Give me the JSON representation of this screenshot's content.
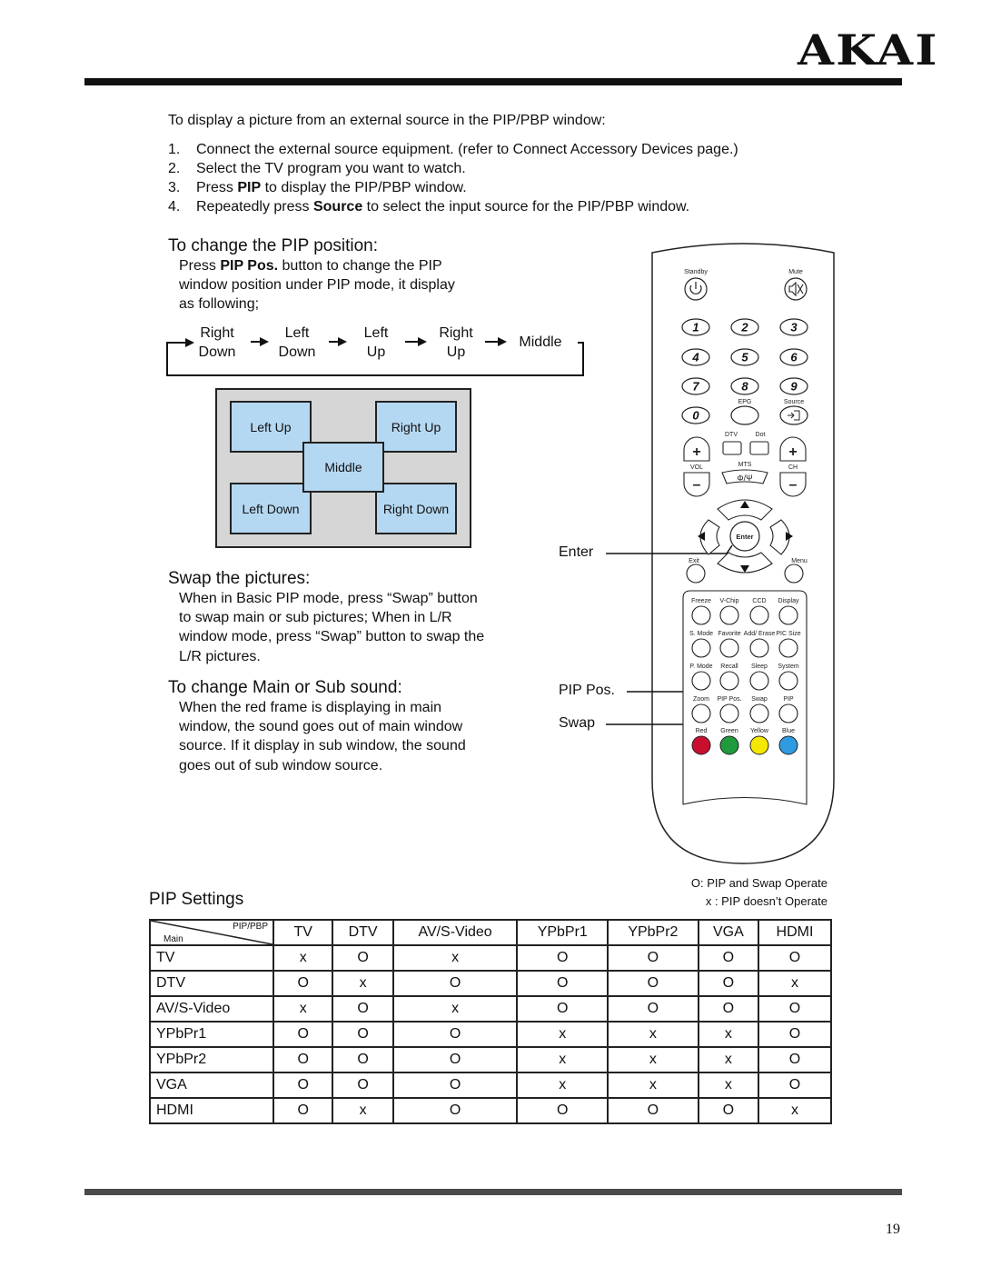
{
  "brand": "AKAI",
  "page_number": "19",
  "intro": "To display a picture from an external source in the PIP/PBP window:",
  "steps": [
    {
      "num": "1.",
      "pre": "Connect the external source equipment. (refer to Connect Accessory Devices page.)",
      "bold": "",
      "post": ""
    },
    {
      "num": "2.",
      "pre": "Select the TV program you want to watch.",
      "bold": "",
      "post": ""
    },
    {
      "num": "3.",
      "pre": "Press ",
      "bold": "PIP",
      "post": " to display the PIP/PBP window."
    },
    {
      "num": "4.",
      "pre": "Repeatedly press ",
      "bold": "Source",
      "post": " to select the input source for the PIP/PBP window."
    }
  ],
  "pip_position": {
    "heading": "To change the PIP position:",
    "text_pre": "Press ",
    "text_bold": "PIP Pos.",
    "text_post1": " button to change the PIP",
    "line2": "window position under PIP mode, it display",
    "line3": "as following;",
    "cycle": [
      {
        "l1": "Right",
        "l2": "Down"
      },
      {
        "l1": "Left",
        "l2": "Down"
      },
      {
        "l1": "Left",
        "l2": "Up"
      },
      {
        "l1": "Right",
        "l2": "Up"
      },
      {
        "l1": "Middle",
        "l2": ""
      }
    ],
    "diagram": {
      "left_up": "Left Up",
      "right_up": "Right Up",
      "middle": "Middle",
      "left_down": "Left Down",
      "right_down": "Right Down"
    }
  },
  "swap": {
    "heading": "Swap the pictures:",
    "lines": [
      "When in Basic PIP mode, press “Swap” button",
      "to swap main or sub pictures; When in L/R",
      "window mode, press “Swap” button to swap the",
      "L/R pictures."
    ]
  },
  "sound": {
    "heading": "To change Main or Sub sound:",
    "lines": [
      "When the red frame is displaying in main",
      "window, the sound goes out of main window",
      "source. If it display in sub window, the sound",
      "goes out of sub window source."
    ]
  },
  "callouts": {
    "enter": "Enter",
    "pip_pos": "PIP Pos.",
    "swap": "Swap"
  },
  "remote": {
    "standby": "Standby",
    "mute": "Mute",
    "digits": [
      "1",
      "2",
      "3",
      "4",
      "5",
      "6",
      "7",
      "8",
      "9",
      "0"
    ],
    "epg": "EPG",
    "source": "Source",
    "dtv": "DTV",
    "dot": "Dot",
    "vol": "VOL",
    "ch": "CH",
    "mts": "MTS",
    "mts_symbol": "Φ/Ψ",
    "enter": "Enter",
    "exit": "Exit",
    "menu": "Menu",
    "function_rows": [
      [
        "Freeze",
        "V-Chip",
        "CCD",
        "Display"
      ],
      [
        "S. Mode",
        "Favorite",
        "Add/ Erase",
        "PIC Size"
      ],
      [
        "P. Mode",
        "Recall",
        "Sleep",
        "System"
      ],
      [
        "Zoom",
        "PIP Pos.",
        "Swap",
        "PIP"
      ]
    ],
    "color_keys": [
      {
        "label": "Red",
        "color": "#c8102e"
      },
      {
        "label": "Green",
        "color": "#1f9a3c"
      },
      {
        "label": "Yellow",
        "color": "#f5e800"
      },
      {
        "label": "Blue",
        "color": "#2e9be0"
      }
    ]
  },
  "legend": {
    "operate": "O: PIP and Swap Operate",
    "not_operate": "x : PIP doesn’t Operate"
  },
  "pip_settings": {
    "title": "PIP Settings",
    "corner_top": "PIP/PBP",
    "corner_bottom": "Main",
    "columns": [
      "TV",
      "DTV",
      "AV/S-Video",
      "YPbPr1",
      "YPbPr2",
      "VGA",
      "HDMI"
    ],
    "rows": [
      {
        "label": "TV",
        "values": [
          "x",
          "O",
          "x",
          "O",
          "O",
          "O",
          "O"
        ]
      },
      {
        "label": "DTV",
        "values": [
          "O",
          "x",
          "O",
          "O",
          "O",
          "O",
          "x"
        ]
      },
      {
        "label": "AV/S-Video",
        "values": [
          "x",
          "O",
          "x",
          "O",
          "O",
          "O",
          "O"
        ]
      },
      {
        "label": "YPbPr1",
        "values": [
          "O",
          "O",
          "O",
          "x",
          "x",
          "x",
          "O"
        ]
      },
      {
        "label": "YPbPr2",
        "values": [
          "O",
          "O",
          "O",
          "x",
          "x",
          "x",
          "O"
        ]
      },
      {
        "label": "VGA",
        "values": [
          "O",
          "O",
          "O",
          "x",
          "x",
          "x",
          "O"
        ]
      },
      {
        "label": "HDMI",
        "values": [
          "O",
          "x",
          "O",
          "O",
          "O",
          "O",
          "x"
        ]
      }
    ]
  }
}
